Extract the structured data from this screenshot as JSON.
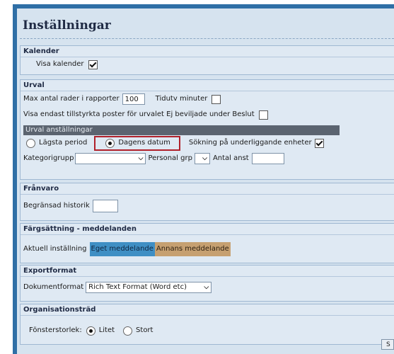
{
  "title": "Inställningar",
  "kalender": {
    "heading": "Kalender",
    "visa_kalender_label": "Visa kalender",
    "visa_kalender_checked": true
  },
  "urval": {
    "heading": "Urval",
    "max_rows_label": "Max antal rader i rapporter",
    "max_rows_value": "100",
    "tidutv_label": "Tidutv minuter",
    "tidutv_checked": false,
    "visa_endast_label": "Visa endast tillstyrkta poster för urvalet Ej beviljade under Beslut",
    "visa_endast_checked": false,
    "sub_heading": "Urval anställningar",
    "radio_lagsta_label": "Lägsta period",
    "radio_dagens_label": "Dagens datum",
    "selected_radio": "Dagens datum",
    "sokning_label": "Sökning på underliggande enheter",
    "sokning_checked": true,
    "kategorigrupp_label": "Kategorigrupp",
    "kategorigrupp_value": "",
    "personal_grp_label": "Personal grp",
    "personal_grp_value": "",
    "antal_anst_label": "Antal anst",
    "antal_anst_value": ""
  },
  "franvaro": {
    "heading": "Frånvaro",
    "begransad_label": "Begränsad historik",
    "begransad_value": ""
  },
  "fargsattning": {
    "heading": "Färgsättning - meddelanden",
    "aktuell_label": "Aktuell inställning",
    "eget_label": "Eget meddelande",
    "annans_label": "Annans meddelande"
  },
  "exportformat": {
    "heading": "Exportformat",
    "dokumentformat_label": "Dokumentformat",
    "dokumentformat_value": "Rich Text Format (Word etc)"
  },
  "organisationstrad": {
    "heading": "Organisationsträd",
    "fonsterstorlek_label": "Fönsterstorlek:",
    "litet_label": "Litet",
    "stort_label": "Stort",
    "selected_size": "Litet"
  },
  "corner_button_label": "S",
  "colors": {
    "frame": "#2f6fa6",
    "panel": "#d6e3ef",
    "eget_highlight": "#3f8fc4",
    "annans_highlight": "#c6a071",
    "selection_box": "#b0202a"
  }
}
